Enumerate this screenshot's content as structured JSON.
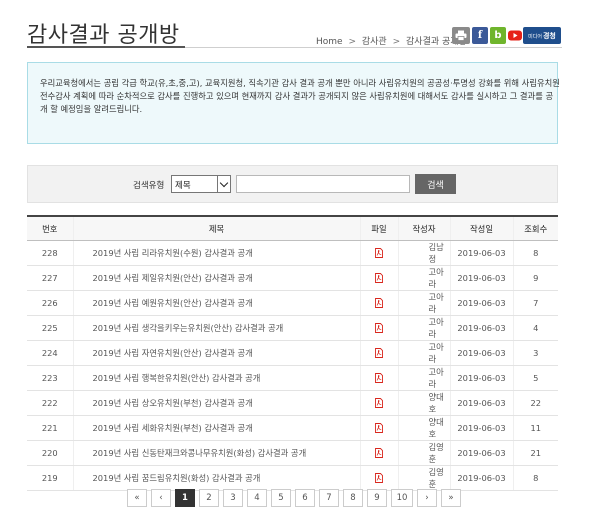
{
  "page": {
    "title": "감사결과 공개방",
    "breadcrumb": [
      "Home",
      "감사관",
      "감사결과 공개방"
    ],
    "breadcrumb_sep": ">"
  },
  "utility": {
    "facebook_label": "f",
    "blog_label": "b",
    "media_small_label": "미디어",
    "media_label": "경청"
  },
  "notice": {
    "text": "우리교육청에서는 공립 각급 학교(유,초,중,고), 교육지원청, 직속기관 감사 결과 공개 뿐만 아니라 사립유치원의 공공성·투명성 강화를 위해 사립유치원 전수감사 계획에 따라 순차적으로 감사를 진행하고 있으며 현재까지 감사 결과가 공개되지 않은 사립유치원에 대해서도 감사를 실시하고 그 결과를 공개 할 예정임을 알려드립니다."
  },
  "search": {
    "label": "검색유형",
    "selected_option": "제목",
    "input_value": "",
    "button_label": "검색"
  },
  "table": {
    "headers": [
      "번호",
      "제목",
      "파일",
      "작성자",
      "작성일",
      "조회수"
    ],
    "rows": [
      {
        "no": "228",
        "title": "2019년 사립 리라유치원(수원) 감사결과 공개",
        "writer": "김남정",
        "date": "2019-06-03",
        "views": "8"
      },
      {
        "no": "227",
        "title": "2019년 사립 제일유치원(안산) 감사결과 공개",
        "writer": "고아라",
        "date": "2019-06-03",
        "views": "9"
      },
      {
        "no": "226",
        "title": "2019년 사립 예원유치원(안산) 감사결과 공개",
        "writer": "고아라",
        "date": "2019-06-03",
        "views": "7"
      },
      {
        "no": "225",
        "title": "2019년 사립 생각을키우는유치원(안산) 감사결과 공개",
        "writer": "고아라",
        "date": "2019-06-03",
        "views": "4"
      },
      {
        "no": "224",
        "title": "2019년 사립 자연유치원(안산) 감사결과 공개",
        "writer": "고아라",
        "date": "2019-06-03",
        "views": "3"
      },
      {
        "no": "223",
        "title": "2019년 사립 행복한유치원(안산) 감사결과 공개",
        "writer": "고아라",
        "date": "2019-06-03",
        "views": "5"
      },
      {
        "no": "222",
        "title": "2019년 사립 상오유치원(부천) 감사결과 공개",
        "writer": "양대호",
        "date": "2019-06-03",
        "views": "22"
      },
      {
        "no": "221",
        "title": "2019년 사립 세화유치원(부천) 감사결과 공개",
        "writer": "양대호",
        "date": "2019-06-03",
        "views": "11"
      },
      {
        "no": "220",
        "title": "2019년 사립 신동탄재크와콩나무유치원(화성) 감사결과 공개",
        "writer": "김영훈",
        "date": "2019-06-03",
        "views": "21"
      },
      {
        "no": "219",
        "title": "2019년 사립 꿈드림유치원(화성) 감사결과 공개",
        "writer": "김영훈",
        "date": "2019-06-03",
        "views": "8"
      }
    ]
  },
  "pagination": {
    "first": "«",
    "prev": "‹",
    "pages": [
      "1",
      "2",
      "3",
      "4",
      "5",
      "6",
      "7",
      "8",
      "9",
      "10"
    ],
    "current": "1",
    "next": "›",
    "last": "»"
  },
  "colors": {
    "accent_dark": "#333333",
    "notice_bg": "#eef9fb",
    "notice_border": "#a9dce6",
    "pdf_red": "#d9261c",
    "facebook": "#3b5998",
    "blog": "#6fb52c",
    "youtube": "#e62117",
    "media": "#1f4e8c"
  },
  "icons": {
    "print": "print-icon",
    "facebook": "facebook-icon",
    "blog": "blog-icon",
    "youtube": "youtube-icon",
    "media": "media-logo",
    "file": "pdf-file-icon",
    "select_arrow": "chevron-down-icon"
  }
}
